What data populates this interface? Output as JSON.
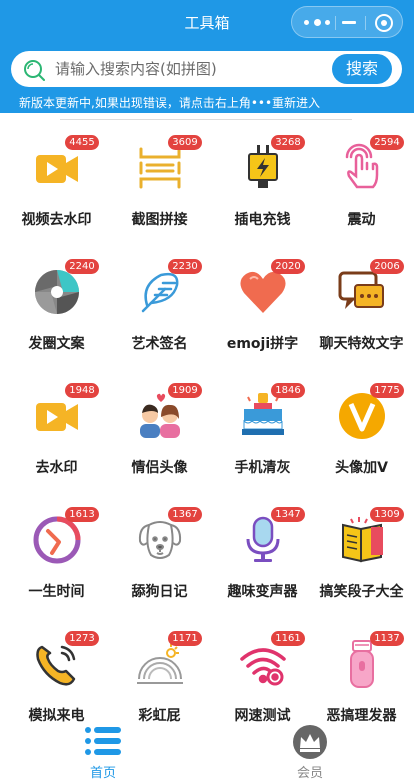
{
  "header": {
    "title": "工具箱",
    "capsule": {
      "more_icon": "more-dots-icon",
      "minimize_icon": "minimize-icon",
      "close_icon": "target-close-icon"
    }
  },
  "search": {
    "placeholder": "请输入搜索内容(如拼图)",
    "button_label": "搜索",
    "icon": "search-icon"
  },
  "notice": "新版本更新中,如果出现错误，请点击右上角•••重新进入",
  "colors": {
    "primary": "#1f98e6",
    "badge": "#e3433f",
    "text": "#222222"
  },
  "tools": [
    {
      "label": "视频去水印",
      "count": "4455",
      "icon": "video-play-icon"
    },
    {
      "label": "截图拼接",
      "count": "3609",
      "icon": "stitch-icon"
    },
    {
      "label": "插电充钱",
      "count": "3268",
      "icon": "plug-charge-icon"
    },
    {
      "label": "震动",
      "count": "2594",
      "icon": "finger-tap-icon"
    },
    {
      "label": "发圈文案",
      "count": "2240",
      "icon": "aperture-icon"
    },
    {
      "label": "艺术签名",
      "count": "2230",
      "icon": "feather-icon"
    },
    {
      "label": "emoji拼字",
      "count": "2020",
      "icon": "heart-icon"
    },
    {
      "label": "聊天特效文字",
      "count": "2006",
      "icon": "chat-bubble-icon"
    },
    {
      "label": "去水印",
      "count": "1948",
      "icon": "video-play-icon"
    },
    {
      "label": "情侣头像",
      "count": "1909",
      "icon": "couple-icon"
    },
    {
      "label": "手机清灰",
      "count": "1846",
      "icon": "cake-icon"
    },
    {
      "label": "头像加V",
      "count": "1775",
      "icon": "v-badge-icon"
    },
    {
      "label": "一生时间",
      "count": "1613",
      "icon": "clock-icon"
    },
    {
      "label": "舔狗日记",
      "count": "1367",
      "icon": "dog-icon"
    },
    {
      "label": "趣味变声器",
      "count": "1347",
      "icon": "microphone-icon"
    },
    {
      "label": "搞笑段子大全",
      "count": "1309",
      "icon": "book-icon"
    },
    {
      "label": "模拟来电",
      "count": "1273",
      "icon": "phone-icon"
    },
    {
      "label": "彩虹屁",
      "count": "1171",
      "icon": "rainbow-icon"
    },
    {
      "label": "网速测试",
      "count": "1161",
      "icon": "wifi-icon"
    },
    {
      "label": "恶搞理发器",
      "count": "1137",
      "icon": "hair-clipper-icon"
    }
  ],
  "tabbar": {
    "home": {
      "label": "首页",
      "icon": "list-icon",
      "active": true
    },
    "vip": {
      "label": "会员",
      "icon": "crown-icon",
      "active": false
    }
  }
}
